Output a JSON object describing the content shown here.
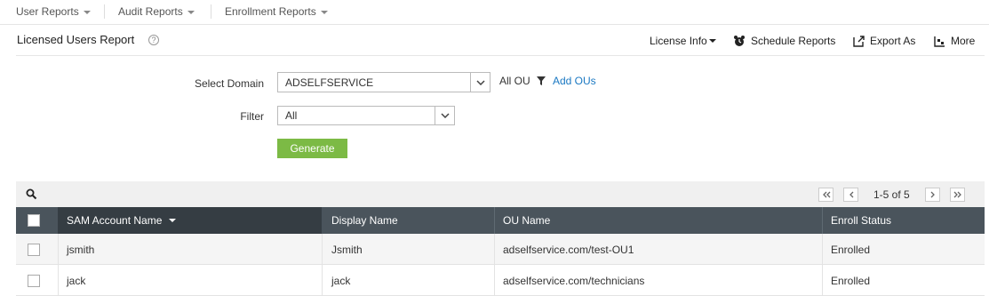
{
  "topnav": {
    "items": [
      {
        "label": "User Reports"
      },
      {
        "label": "Audit Reports"
      },
      {
        "label": "Enrollment Reports"
      }
    ]
  },
  "report": {
    "title": "Licensed Users Report",
    "help_glyph": "?"
  },
  "toolbar": {
    "license_info": "License Info",
    "schedule_reports": "Schedule Reports",
    "export_as": "Export As",
    "more": "More"
  },
  "form": {
    "domain_label": "Select Domain",
    "domain_value": "ADSELFSERVICE",
    "ou_text": "All OU",
    "add_ous": "Add OUs",
    "filter_label": "Filter",
    "filter_value": "All",
    "generate_label": "Generate"
  },
  "pager": {
    "range_text": "1-5 of 5"
  },
  "table": {
    "columns": [
      "SAM Account Name",
      "Display Name",
      "OU Name",
      "Enroll Status"
    ],
    "rows": [
      {
        "sam": "jsmith",
        "display": "Jsmith",
        "ou": "adselfservice.com/test-OU1",
        "status": "Enrolled"
      },
      {
        "sam": "jack",
        "display": "jack",
        "ou": "adselfservice.com/technicians",
        "status": "Enrolled"
      }
    ]
  },
  "colors": {
    "accent_green": "#7cba45",
    "header_dark": "#4a545c",
    "link_blue": "#1a78c2"
  }
}
